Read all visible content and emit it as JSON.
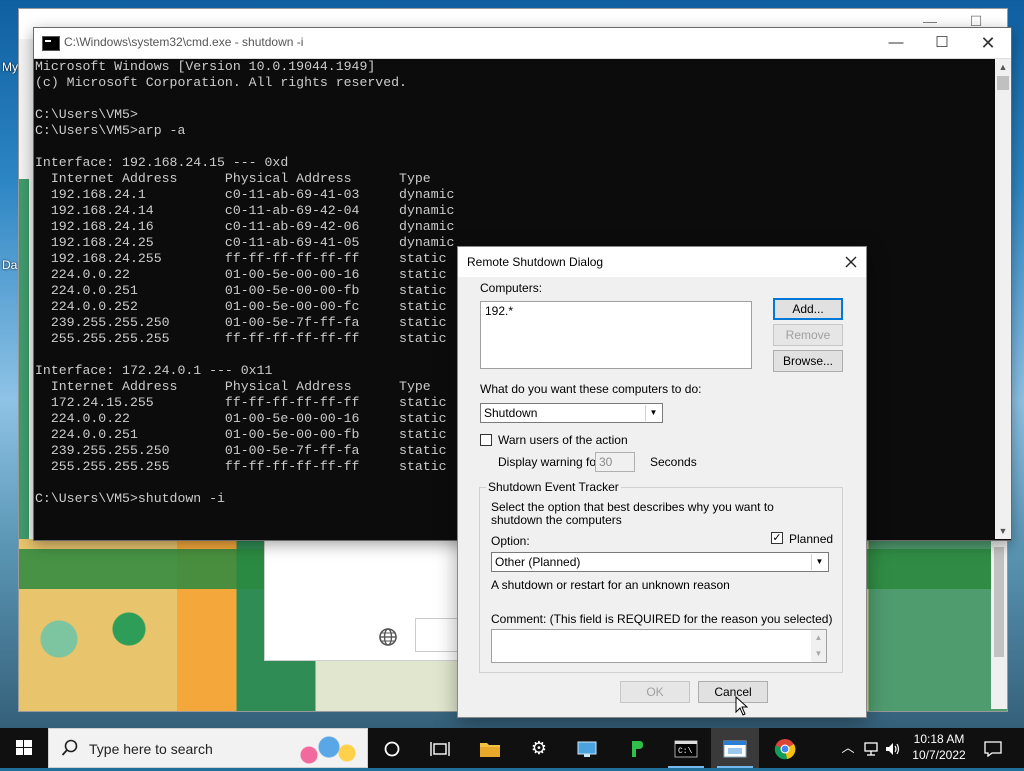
{
  "desktop": {
    "labels": [
      "My",
      "Da"
    ]
  },
  "cmd": {
    "title": "C:\\Windows\\system32\\cmd.exe - shutdown  -i",
    "lines": [
      "Microsoft Windows [Version 10.0.19044.1949]",
      "(c) Microsoft Corporation. All rights reserved.",
      "",
      "C:\\Users\\VM5>",
      "C:\\Users\\VM5>arp -a",
      "",
      "Interface: 192.168.24.15 --- 0xd",
      "  Internet Address      Physical Address      Type",
      "  192.168.24.1          c0-11-ab-69-41-03     dynamic",
      "  192.168.24.14         c0-11-ab-69-42-04     dynamic",
      "  192.168.24.16         c0-11-ab-69-42-06     dynamic",
      "  192.168.24.25         c0-11-ab-69-41-05     dynamic",
      "  192.168.24.255        ff-ff-ff-ff-ff-ff     static",
      "  224.0.0.22            01-00-5e-00-00-16     static",
      "  224.0.0.251           01-00-5e-00-00-fb     static",
      "  224.0.0.252           01-00-5e-00-00-fc     static",
      "  239.255.255.250       01-00-5e-7f-ff-fa     static",
      "  255.255.255.255       ff-ff-ff-ff-ff-ff     static",
      "",
      "Interface: 172.24.0.1 --- 0x11",
      "  Internet Address      Physical Address      Type",
      "  172.24.15.255         ff-ff-ff-ff-ff-ff     static",
      "  224.0.0.22            01-00-5e-00-00-16     static",
      "  224.0.0.251           01-00-5e-00-00-fb     static",
      "  239.255.255.250       01-00-5e-7f-ff-fa     static",
      "  255.255.255.255       ff-ff-ff-ff-ff-ff     static",
      "",
      "C:\\Users\\VM5>shutdown -i"
    ]
  },
  "dialog": {
    "title": "Remote Shutdown Dialog",
    "computers_label": "Computers:",
    "computers": [
      "192.*"
    ],
    "add_button": "Add...",
    "remove_button": "Remove",
    "browse_button": "Browse...",
    "action_question": "What do you want these computers to do:",
    "action_value": "Shutdown",
    "warn_label": "Warn users of the action",
    "warn_checked": false,
    "display_warning_label": "Display warning for",
    "warning_seconds": "30",
    "seconds_label": "Seconds",
    "tracker": {
      "title": "Shutdown Event Tracker",
      "description": "Select the option that best describes why you want to shutdown the computers",
      "option_label": "Option:",
      "planned_label": "Planned",
      "planned_checked": true,
      "option_value": "Other (Planned)",
      "option_description": "A shutdown or restart for an unknown reason",
      "comment_label": "Comment: (This field is REQUIRED for the reason you selected)",
      "comment_value": ""
    },
    "ok_button": "OK",
    "cancel_button": "Cancel"
  },
  "taskbar": {
    "search_placeholder": "Type here to search",
    "time": "10:18 AM",
    "date": "10/7/2022"
  }
}
